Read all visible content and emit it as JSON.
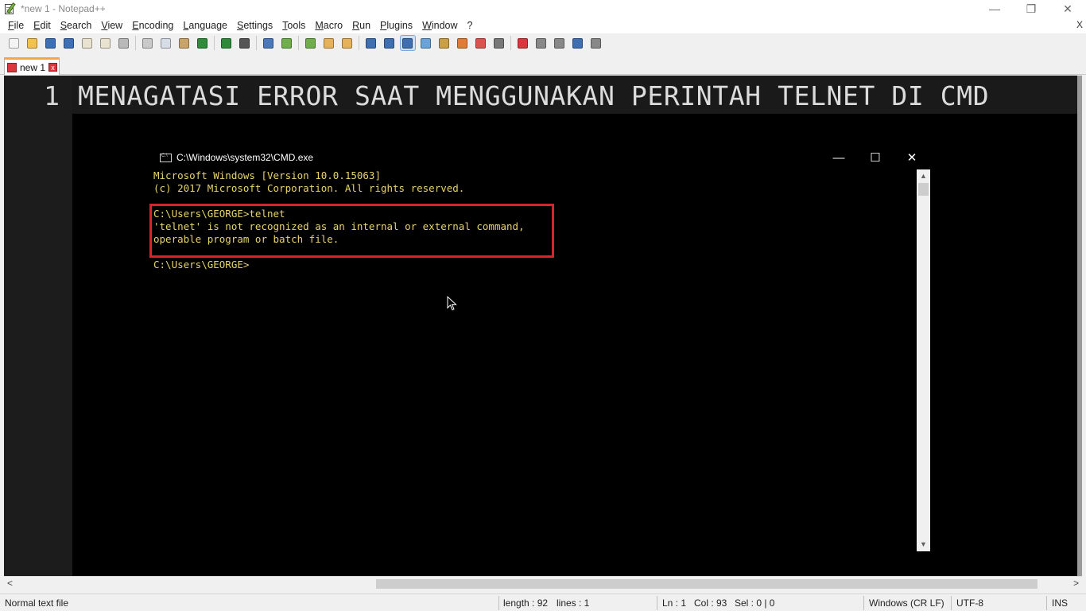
{
  "window": {
    "title": "*new 1 - Notepad++",
    "controls": {
      "minimize": "—",
      "restore": "❐",
      "close": "✕"
    }
  },
  "menu": {
    "items": [
      "File",
      "Edit",
      "Search",
      "View",
      "Encoding",
      "Language",
      "Settings",
      "Tools",
      "Macro",
      "Run",
      "Plugins",
      "Window",
      "?"
    ],
    "close_label": "X"
  },
  "toolbar": {
    "buttons": [
      {
        "name": "new-file-icon",
        "color": "#f4f4f4"
      },
      {
        "name": "open-file-icon",
        "color": "#f2c14e"
      },
      {
        "name": "save-icon",
        "color": "#3d6fb6"
      },
      {
        "name": "save-all-icon",
        "color": "#3d6fb6"
      },
      {
        "name": "close-file-icon",
        "color": "#e9e2d0"
      },
      {
        "name": "close-all-icon",
        "color": "#e9e2d0"
      },
      {
        "name": "print-icon",
        "color": "#b9b9b9"
      },
      {
        "name": "cut-icon",
        "color": "#c9c9c9"
      },
      {
        "name": "copy-icon",
        "color": "#d7dde6"
      },
      {
        "name": "paste-icon",
        "color": "#c8a46a"
      },
      {
        "name": "undo-icon",
        "color": "#2f8a3a"
      },
      {
        "name": "redo-icon",
        "color": "#2f8a3a"
      },
      {
        "name": "find-icon",
        "color": "#555555"
      },
      {
        "name": "replace-icon",
        "color": "#4a78b8"
      },
      {
        "name": "zoom-in-icon",
        "color": "#6fae4a"
      },
      {
        "name": "zoom-out-icon",
        "color": "#6fae4a"
      },
      {
        "name": "sync-vertical-icon",
        "color": "#e5b15a"
      },
      {
        "name": "sync-horizontal-icon",
        "color": "#e5b15a"
      },
      {
        "name": "word-wrap-icon",
        "color": "#3f6fb0"
      },
      {
        "name": "show-all-chars-icon",
        "color": "#3f6fb0"
      },
      {
        "name": "indent-guide-icon",
        "color": "#3f6fb0"
      },
      {
        "name": "document-map-icon",
        "color": "#6aa3d8"
      },
      {
        "name": "function-list-icon",
        "color": "#caa044"
      },
      {
        "name": "folder-as-workspace-icon",
        "color": "#e07b39"
      },
      {
        "name": "monitoring-icon",
        "color": "#d9534f"
      },
      {
        "name": "doc-switcher-icon",
        "color": "#777777"
      },
      {
        "name": "record-macro-icon",
        "color": "#d9363e"
      },
      {
        "name": "stop-record-icon",
        "color": "#888888"
      },
      {
        "name": "play-macro-icon",
        "color": "#888888"
      },
      {
        "name": "play-multiple-icon",
        "color": "#3f6fb0"
      },
      {
        "name": "save-macro-icon",
        "color": "#888888"
      }
    ]
  },
  "tab": {
    "label": "new 1",
    "close_glyph": "x",
    "accent_color": "#f7a44a"
  },
  "editor": {
    "line_number": "1",
    "line_text": "MENAGATASI ERROR SAAT MENGGUNAKAN PERINTAH TELNET DI CMD"
  },
  "cmd": {
    "title": "C:\\Windows\\system32\\CMD.exe",
    "controls": {
      "minimize": "—",
      "maximize": "☐",
      "close": "✕"
    },
    "text_color": "#e8d36b",
    "lines": [
      "Microsoft Windows [Version 10.0.15063]",
      "(c) 2017 Microsoft Corporation. All rights reserved.",
      "",
      "C:\\Users\\GEORGE>telnet",
      "'telnet' is not recognized as an internal or external command,",
      "operable program or batch file.",
      "",
      "C:\\Users\\GEORGE>"
    ],
    "scroll_up": "▲",
    "scroll_down": "▼",
    "highlight_color": "#d4242c"
  },
  "hscroll": {
    "left": "<",
    "right": ">"
  },
  "status": {
    "file_type": "Normal text file",
    "length": "length : 92",
    "lines": "lines : 1",
    "ln": "Ln : 1",
    "col": "Col : 93",
    "sel": "Sel : 0 | 0",
    "eol": "Windows (CR LF)",
    "encoding": "UTF-8",
    "mode": "INS"
  }
}
